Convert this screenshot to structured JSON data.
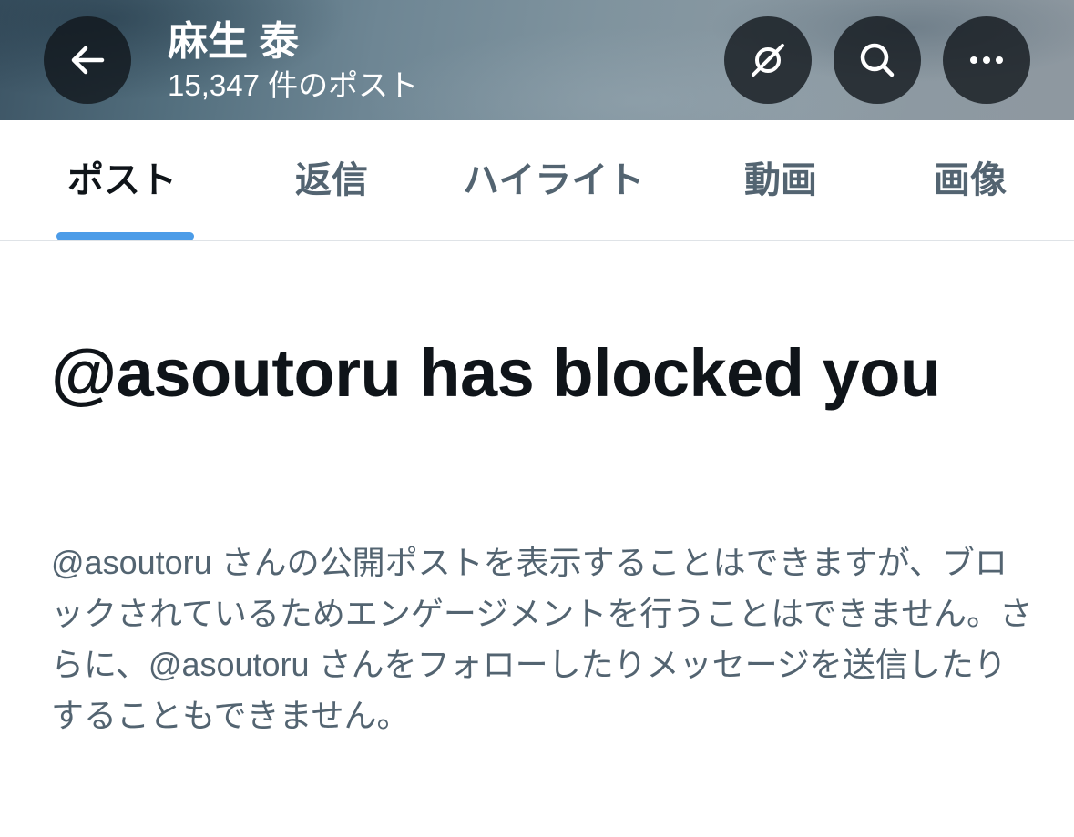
{
  "header": {
    "title": "麻生 泰",
    "post_count": "15,347 件のポスト",
    "buttons": {
      "back_icon": "arrow-left-icon",
      "nosat_icon": "satellite-off-icon",
      "search_icon": "search-icon",
      "more_icon": "more-horizontal-icon"
    }
  },
  "tabs": [
    {
      "label": "ポスト",
      "active": true
    },
    {
      "label": "返信",
      "active": false
    },
    {
      "label": "ハイライト",
      "active": false
    },
    {
      "label": "動画",
      "active": false
    },
    {
      "label": "画像",
      "active": false
    }
  ],
  "blocked": {
    "title": "@asoutoru has blocked you",
    "description": "@asoutoru さんの公開ポストを表示することはできますが、ブロックされているためエンゲージメントを行うことはできません。さらに、@asoutoru さんをフォローしたりメッセージを送信したりすることもできません。"
  },
  "colors": {
    "tab_indicator": "#4c9ce8",
    "primary_text": "#0f1419",
    "secondary_text": "#536471"
  }
}
